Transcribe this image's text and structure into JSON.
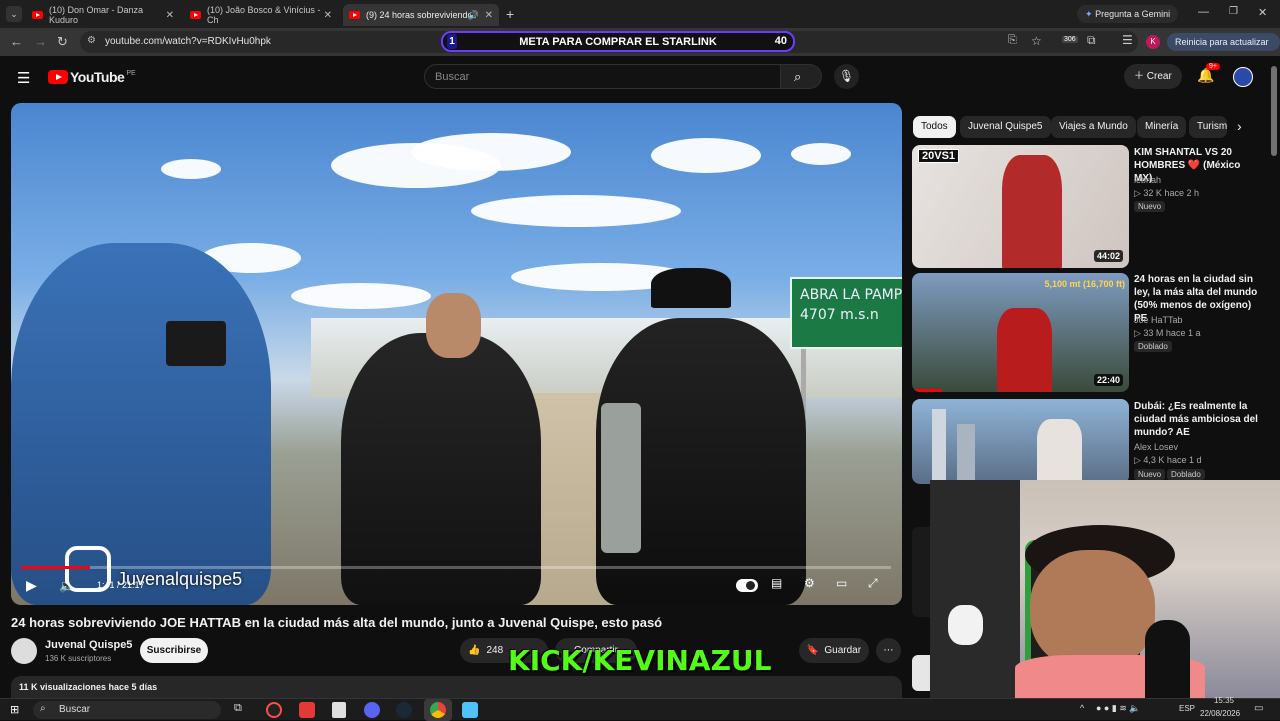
{
  "browser": {
    "tabs": [
      {
        "label": "(10) Don Omar - Danza Kuduro",
        "active": false
      },
      {
        "label": "(10) João Bosco & Vinícius - Ch",
        "active": false
      },
      {
        "label": "(9) 24 horas sobreviviendo",
        "active": true
      }
    ],
    "gemini_label": "Pregunta a Gemini",
    "url": "youtube.com/watch?v=RDKIvHu0hpk",
    "update_label": "Reinicia para actualizar",
    "profile_letter": "K",
    "ext_badge": "306"
  },
  "stream_overlay": {
    "left": "1",
    "text": "META PARA COMPRAR EL STARLINK",
    "right": "40"
  },
  "yt_header": {
    "logo": "YouTube",
    "region": "PE",
    "search_placeholder": "Buscar",
    "create_label": "Crear",
    "notif_count": "9+"
  },
  "player": {
    "time": "1:41 / 21:17",
    "progress_fraction": 0.079,
    "watermark": "Juvenalquispe5",
    "sign_line1": "ABRA LA PAMP",
    "sign_line2": "4707  m.s.n"
  },
  "video": {
    "title": "24 horas sobreviviendo JOE HATTAB en la ciudad más alta del mundo, junto a Juvenal Quispe, esto pasó",
    "channel": "Juvenal Quispe5",
    "subscribers": "136 K suscriptores",
    "subscribe_label": "Suscribirse",
    "likes": "248",
    "share_label": "Compartir",
    "save_label": "Guardar",
    "views": "11 K visualizaciones  hace 5 días"
  },
  "kick_overlay": "KICK/KEVINAZUL",
  "chips": [
    "Todos",
    "Juvenal Quispe5",
    "Viajes a Mundo",
    "Minería",
    "Turism"
  ],
  "recommendations": [
    {
      "title": "KIM SHANTAL VS 20 HOMBRES ❤️ (México MX)",
      "channel": "lebriah",
      "meta": "▷ 32 K  hace 2 h",
      "badges": [
        "Nuevo"
      ],
      "duration": "44:02",
      "thumb_text": "20VS1"
    },
    {
      "title": "24 horas en la ciudad sin ley, la más alta del mundo (50% menos de oxígeno) PE",
      "channel": "Joe HaTTab",
      "meta": "▷ 33 M  hace 1 a",
      "badges": [
        "Doblado"
      ],
      "duration": "22:40",
      "thumb_text": "5,100 mt (16,700 ft)"
    },
    {
      "title": "Dubái: ¿Es realmente la ciudad más ambiciosa del mundo? AE",
      "channel": "Alex Losev",
      "meta": "▷ 4,3 K  hace 1 d",
      "badges": [
        "Nuevo",
        "Doblado"
      ],
      "duration": "",
      "thumb_text": ""
    }
  ],
  "taskbar": {
    "search_placeholder": "Buscar",
    "lang": "ESP",
    "time": "15:35",
    "date": "22/08/2026"
  },
  "colors": {
    "accent_red": "#ff0000",
    "kick_green": "#53fc18",
    "overlay_border": "#6d3cff"
  }
}
